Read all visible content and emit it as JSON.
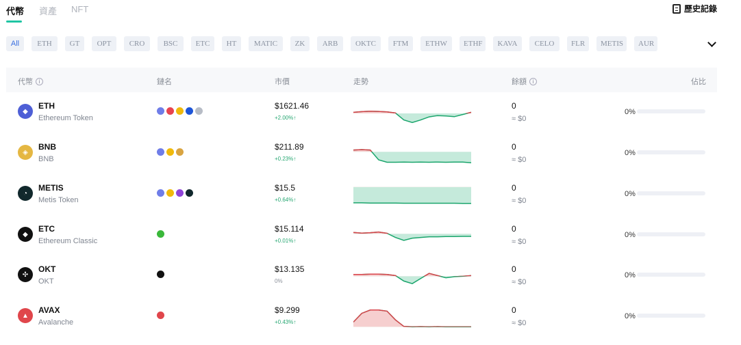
{
  "tabs": [
    {
      "label": "代幣",
      "active": true
    },
    {
      "label": "資產",
      "active": false
    },
    {
      "label": "NFT",
      "active": false
    }
  ],
  "history_label": "歷史記錄",
  "chips": [
    "All",
    "ETH",
    "GT",
    "OPT",
    "CRO",
    "BSC",
    "ETC",
    "HT",
    "MATIC",
    "ZK",
    "ARB",
    "OKTC",
    "FTM",
    "ETHW",
    "ETHF",
    "KAVA",
    "CELO",
    "FLR",
    "METIS",
    "AUR"
  ],
  "table": {
    "headers": {
      "token": "代幣",
      "chain": "鏈名",
      "price": "市價",
      "trend": "走勢",
      "balance": "餘額",
      "share": "佔比"
    }
  },
  "tokens": [
    {
      "symbol": "ETH",
      "name": "Ethereum Token",
      "icon_color": "#4e5fd6",
      "icon": "eth-icon",
      "icon_glyph": "◆",
      "chains": [
        "#6f7de8",
        "#e8434f",
        "#f0b90b",
        "#1d55d8",
        "#b7bcc6"
      ],
      "price": "$1621.46",
      "change": "+2.00%↑",
      "trend": [
        0.45,
        0.42,
        0.4,
        0.41,
        0.43,
        0.48,
        0.8,
        0.92,
        0.8,
        0.66,
        0.6,
        0.62,
        0.65,
        0.55,
        0.45
      ],
      "baseline": 0.5,
      "balance": "0",
      "balance_value": "≈ $0",
      "share": "0%",
      "share_fraction": 0
    },
    {
      "symbol": "BNB",
      "name": "BNB",
      "icon_color": "#e5b742",
      "icon": "bnb-icon",
      "icon_glyph": "◈",
      "chains": [
        "#6f7de8",
        "#f0b90b",
        "#d9a441"
      ],
      "price": "$211.89",
      "change": "+0.23%↑",
      "trend": [
        0.3,
        0.28,
        0.3,
        0.75,
        0.86,
        0.86,
        0.85,
        0.86,
        0.85,
        0.86,
        0.85,
        0.86,
        0.85,
        0.85,
        0.88
      ],
      "baseline": 0.38,
      "balance": "0",
      "balance_value": "≈ $0",
      "share": "0%",
      "share_fraction": 0
    },
    {
      "symbol": "METIS",
      "name": "Metis Token",
      "icon_color": "#11282c",
      "icon": "metis-icon",
      "icon_glyph": "◔",
      "chains": [
        "#6f7de8",
        "#f0b90b",
        "#8e44d8",
        "#11282c"
      ],
      "price": "$15.5",
      "change": "+0.64%↑",
      "trend": [
        0.84,
        0.84,
        0.85,
        0.85,
        0.85,
        0.85,
        0.86,
        0.86,
        0.86,
        0.86,
        0.86,
        0.86,
        0.86,
        0.87,
        0.87
      ],
      "baseline": 0.12,
      "balance": "0",
      "balance_value": "≈ $0",
      "share": "0%",
      "share_fraction": 0
    },
    {
      "symbol": "ETC",
      "name": "Ethereum Classic",
      "icon_color": "#111111",
      "icon": "etc-icon",
      "icon_glyph": "◆",
      "chains": [
        "#3ab83a"
      ],
      "price": "$15.114",
      "change": "+0.01%↑",
      "trend": [
        0.32,
        0.35,
        0.33,
        0.3,
        0.36,
        0.55,
        0.68,
        0.58,
        0.55,
        0.52,
        0.52,
        0.51,
        0.51,
        0.5,
        0.5
      ],
      "baseline": 0.38,
      "balance": "0",
      "balance_value": "≈ $0",
      "share": "0%",
      "share_fraction": 0
    },
    {
      "symbol": "OKT",
      "name": "OKT",
      "icon_color": "#111111",
      "icon": "okt-icon",
      "icon_glyph": "✣",
      "chains": [
        "#111111"
      ],
      "price": "$13.135",
      "change": "0%",
      "trend": [
        0.4,
        0.4,
        0.38,
        0.38,
        0.4,
        0.45,
        0.7,
        0.82,
        0.58,
        0.35,
        0.45,
        0.55,
        0.5,
        0.48,
        0.45
      ],
      "baseline": 0.48,
      "balance": "0",
      "balance_value": "≈ $0",
      "share": "0%",
      "share_fraction": 0
    },
    {
      "symbol": "AVAX",
      "name": "Avalanche",
      "icon_color": "#e0464b",
      "icon": "avax-icon",
      "icon_glyph": "▲",
      "chains": [
        "#e0464b"
      ],
      "price": "$9.299",
      "change": "+0.43%↑",
      "trend": [
        0.7,
        0.3,
        0.15,
        0.15,
        0.2,
        0.6,
        0.9,
        0.92,
        0.91,
        0.92,
        0.91,
        0.92,
        0.92,
        0.92,
        0.92
      ],
      "baseline": 0.92,
      "balance": "0",
      "balance_value": "≈ $0",
      "share": "0%",
      "share_fraction": 0
    }
  ]
}
